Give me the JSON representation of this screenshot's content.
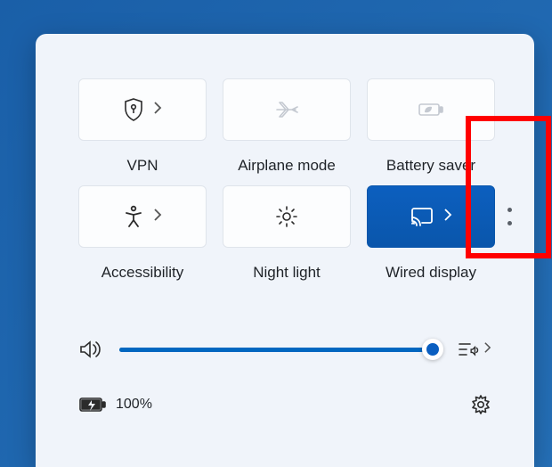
{
  "tiles": [
    {
      "key": "vpn",
      "label": "VPN"
    },
    {
      "key": "airplane",
      "label": "Airplane mode"
    },
    {
      "key": "battery_saver",
      "label": "Battery saver"
    },
    {
      "key": "accessibility",
      "label": "Accessibility"
    },
    {
      "key": "night_light",
      "label": "Night light"
    },
    {
      "key": "wired_display",
      "label": "Wired display"
    }
  ],
  "volume": {
    "level_percent": 98
  },
  "battery": {
    "percent_text": "100%"
  }
}
